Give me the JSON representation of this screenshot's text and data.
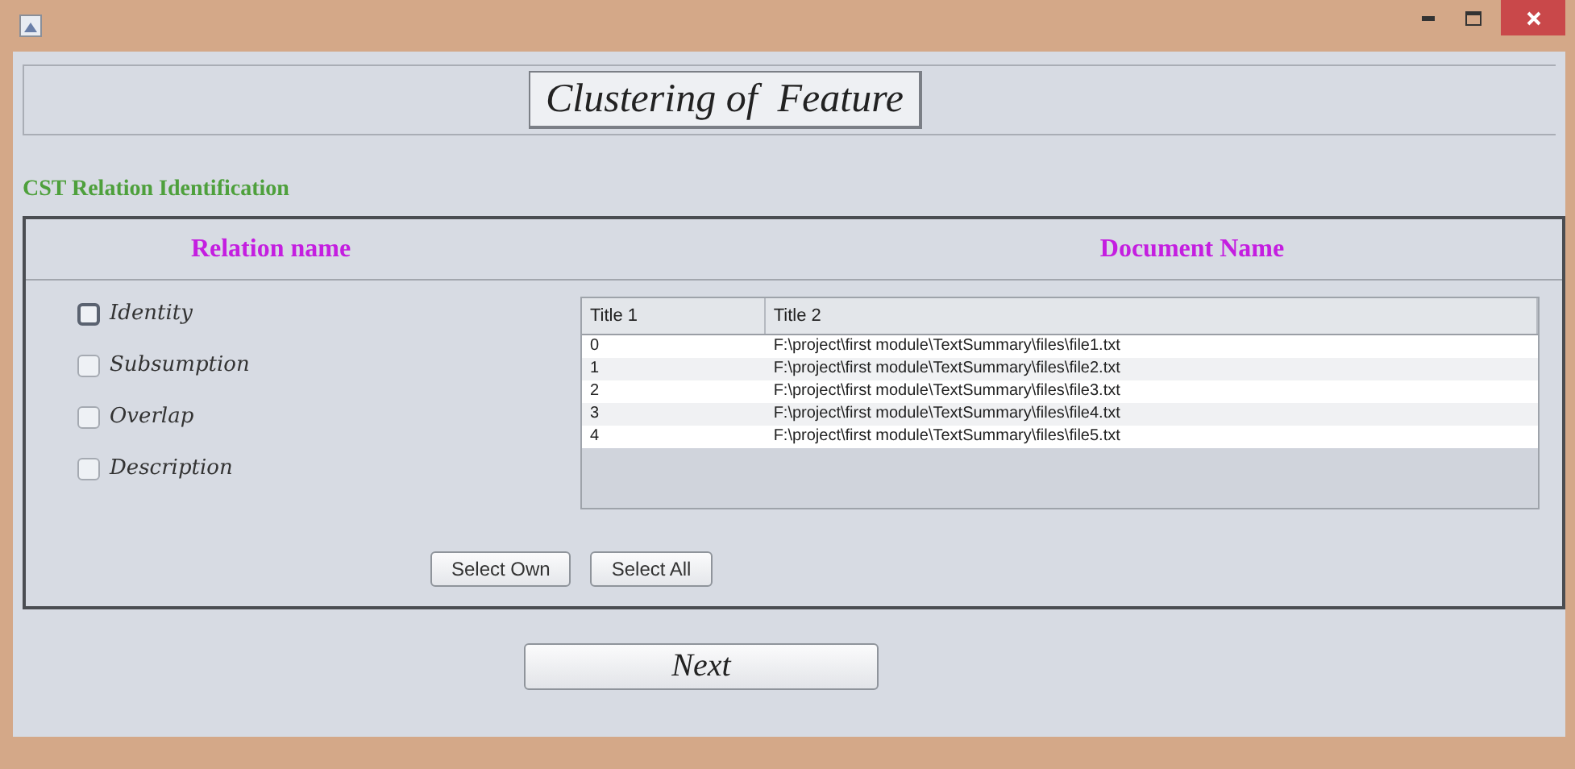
{
  "window": {
    "title_bar_buttons": [
      {
        "kind": "minimize"
      },
      {
        "kind": "maximize"
      },
      {
        "kind": "close"
      }
    ]
  },
  "header": {
    "title": "Clustering of  Feature"
  },
  "section_label": "CST Relation Identification",
  "panel": {
    "left_heading": "Relation name",
    "right_heading": "Document Name",
    "relations": [
      {
        "label": "Identity",
        "checked": false,
        "focused": true
      },
      {
        "label": "Subsumption",
        "checked": false,
        "focused": false
      },
      {
        "label": "Overlap",
        "checked": false,
        "focused": false
      },
      {
        "label": "Description",
        "checked": false,
        "focused": false
      }
    ],
    "table": {
      "columns": [
        "Title 1",
        "Title 2"
      ],
      "rows": [
        [
          "0",
          "F:\\project\\first module\\TextSummary\\files\\file1.txt"
        ],
        [
          "1",
          "F:\\project\\first module\\TextSummary\\files\\file2.txt"
        ],
        [
          "2",
          "F:\\project\\first module\\TextSummary\\files\\file3.txt"
        ],
        [
          "3",
          "F:\\project\\first module\\TextSummary\\files\\file4.txt"
        ],
        [
          "4",
          "F:\\project\\first module\\TextSummary\\files\\file5.txt"
        ]
      ]
    },
    "buttons": [
      "Select Own",
      "Select All"
    ]
  },
  "next_button": "Next"
}
